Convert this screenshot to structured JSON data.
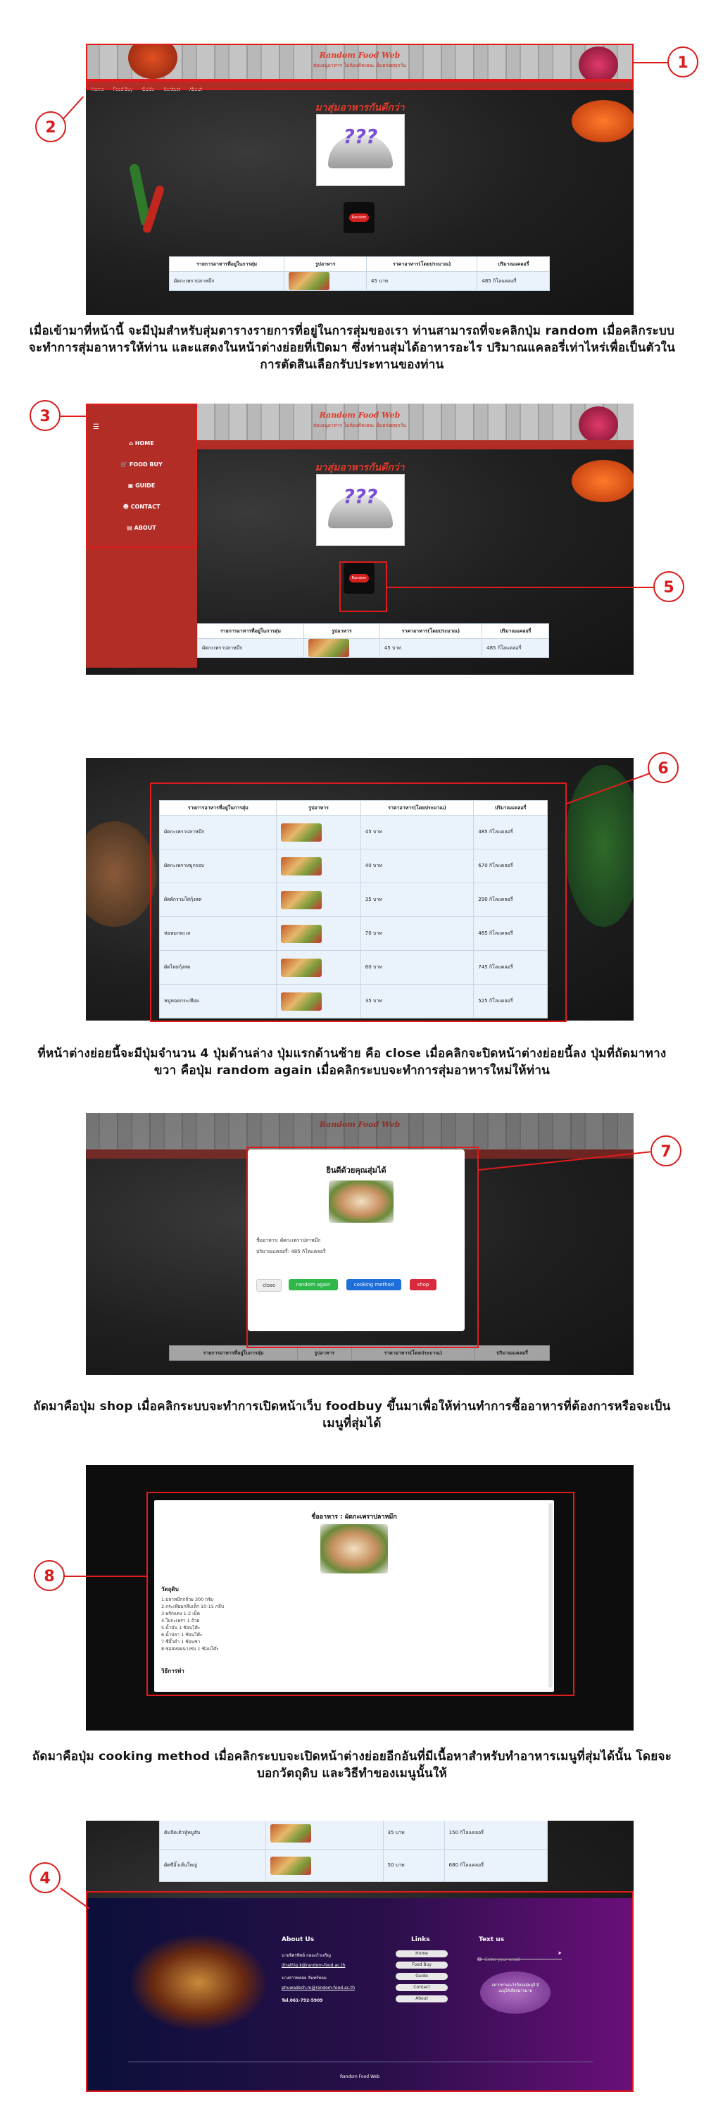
{
  "site": {
    "title": "Random Food Web",
    "subtitle": "สุ่มเมนูอาหาร ไม่ต้องคิดเยอะ อิ่มอร่อยทุกวัน",
    "nav": [
      "Home",
      "Food Buy",
      "Guide",
      "Contact",
      "About"
    ],
    "pick_heading": "มาสุ่มอาหารกันดีกว่า",
    "cloche_text": "???",
    "random_button": "Random"
  },
  "sidebar": {
    "items": [
      "HOME",
      "FOOD BUY",
      "GUIDE",
      "CONTACT",
      "ABOUT"
    ]
  },
  "table": {
    "headers": [
      "รายการอาหารที่อยู่ในการสุ่ม",
      "รูปอาหาร",
      "ราคาอาหาร(โดยประมาณ)",
      "ปริมาณแคลอรี่"
    ],
    "rows": [
      [
        "ผัดกะเพราปลาหมึก",
        "45 บาท",
        "485 กิโลแคลอรี่"
      ],
      [
        "ผัดกะเพราหมูกรอบ",
        "40 บาท",
        "670 กิโลแคลอรี่"
      ],
      [
        "ผัดผักรวมใส่กุ้งสด",
        "35 บาท",
        "290 กิโลแคลอรี่"
      ],
      [
        "ห่อหมกทะเล",
        "70 บาท",
        "485 กิโลแคลอรี่"
      ],
      [
        "ผัดไทยกุ้งสด",
        "60 บาท",
        "745 กิโลแคลอรี่"
      ],
      [
        "หมูทอดกระเทียม",
        "35 บาท",
        "525 กิโลแคลอรี่"
      ]
    ],
    "footer_rows": [
      [
        "ต้มจืดเต้าหู้หมูสับ",
        "35 บาท",
        "150 กิโลแคลอรี่"
      ],
      [
        "ผัดซีอิ๊วเส้นใหญ่",
        "50 บาท",
        "680 กิโลแคลอรี่"
      ]
    ]
  },
  "captions": {
    "c1": "เมื่อเข้ามาที่หน้านี้ จะมีปุ่มสำหรับสุ่มตารางรายการที่อยู่ในการสุ่มของเรา ท่านสามารถที่จะคลิกปุ่ม random เมื่อคลิกระบบจะทำการสุ่มอาหารให้ท่าน และแสดงในหน้าต่างย่อยที่เปิดมา ซึ่งท่านสุ่มได้อาหารอะไร ปริมาณแคลอรี่เท่าไหร่เพื่อเป็นตัวในการตัดสินเลือกรับประทานของท่าน",
    "c2": "ที่หน้าต่างย่อยนี้จะมีปุ่มจำนวน 4 ปุ่มด้านล่าง ปุ่มแรกด้านซ้าย คือ close เมื่อคลิกจะปิดหน้าต่างย่อยนี้ลง ปุ่มที่ถัดมาทางขวา คือปุ่ม random again เมื่อคลิกระบบจะทำการสุ่มอาหารใหม่ให้ท่าน",
    "c3": "ถัดมาคือปุ่ม shop เมื่อคลิกระบบจะทำการเปิดหน้าเว็บ foodbuy ขึ้นมาเพื่อให้ท่านทำการซื้ออาหารที่ต้องการหรือจะเป็นเมนูที่สุ่มได้",
    "c4": "ถัดมาคือปุ่ม cooking method เมื่อคลิกระบบจะเปิดหน้าต่างย่อยอีกอันที่มีเนื้อหาสำหรับทำอาหารเมนูที่สุ่มได้นั้น โดยจะบอกวัตถุดิบ และวิธีทำของเมนูนั้นให้"
  },
  "modal": {
    "heading": "ยินดีด้วยคุณสุ่มได้",
    "name_line": "ชื่ออาหาร: ผัดกะเพราปลาหมึก",
    "cal_line": "ปริมาณแคลอรี่: 485 กิโลแคลอรี่",
    "buttons": [
      "close",
      "random again",
      "cooking method",
      "shop"
    ]
  },
  "recipe": {
    "title": "ชื่ออาหาร : ผัดกะเพราปลาหมึก",
    "ingredients_label": "วัตถุดิบ",
    "ingredients": [
      "1.ปลาหมึกกล้วย 300 กรัม",
      "2.กระเทียมกลีบเล็ก 10-15 กลีบ",
      "3.พริกแดง 1-2 เม็ด",
      "4.ใบกะเพรา 1 ถ้วย",
      "5.น้ำมัน 1 ช้อนโต๊ะ",
      "6.น้ำปลา 1 ช้อนโต๊ะ",
      "7.ซีอิ๊วดำ 1 ช้อนชา",
      "8.ซอสหอยนางรม 1 ช้อนโต๊ะ"
    ],
    "method_label": "วิธีการทำ"
  },
  "footer": {
    "about_heading": "About Us",
    "about_lines": [
      "นายจิตรทิพย์ กองแก้วเจริญ",
      "jitrathip.k@random-food.ac.th",
      "นางสาวพลอย จันทร์หอม",
      "phuwadech.m@random-food.ac.th",
      "Tel.061-792-5909"
    ],
    "links_heading": "Links",
    "links": [
      "Home",
      "Food Buy",
      "Guide",
      "Contact",
      "About"
    ],
    "text_heading": "Text us",
    "text_placeholder": "Enter your email",
    "promo": "อยากทานอะไรก็ลองสุ่มดูสิ มีเมนูให้เลือกมากมาย",
    "copyright": "Random Food Web"
  },
  "markers": [
    "1",
    "2",
    "3",
    "4",
    "5",
    "6",
    "7",
    "8"
  ],
  "colors": {
    "accent": "#e01b1b",
    "nav": "#b32d27"
  }
}
